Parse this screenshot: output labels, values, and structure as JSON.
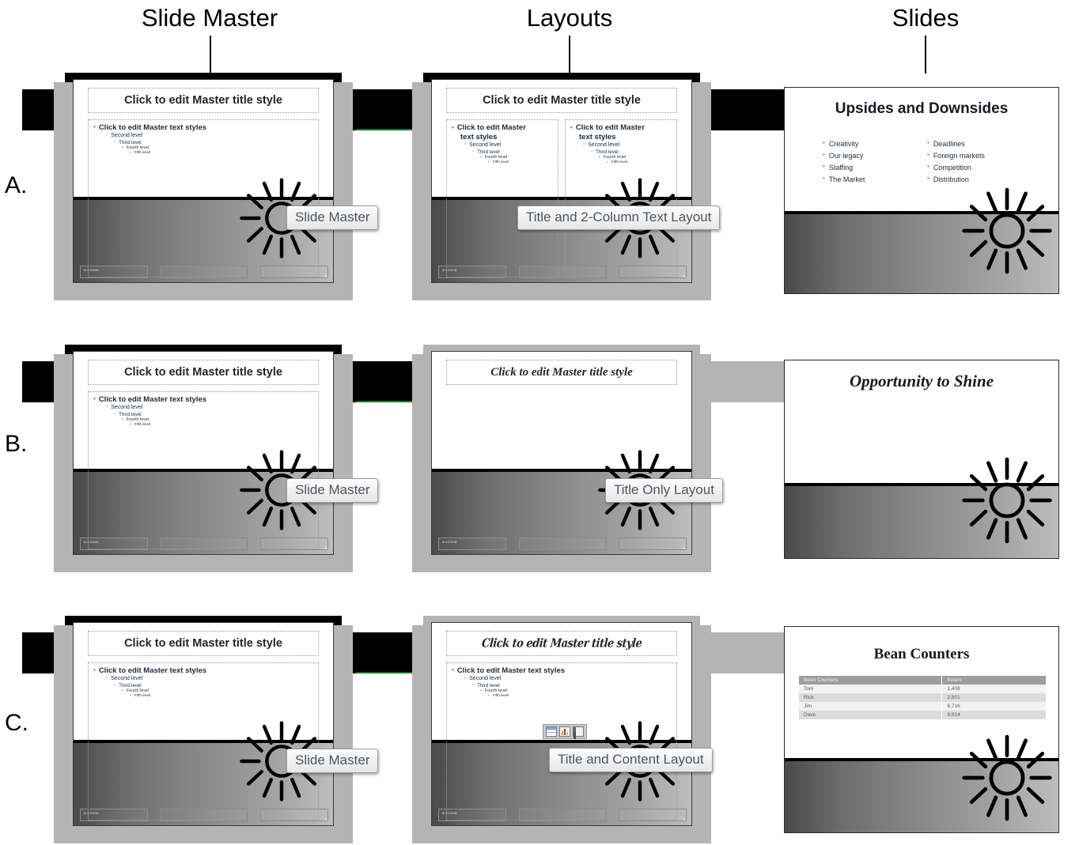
{
  "headers": {
    "slide_master": "Slide Master",
    "layouts": "Layouts",
    "slides": "Slides"
  },
  "row_labels": {
    "a": "A.",
    "b": "B.",
    "c": "C."
  },
  "master": {
    "title_placeholder": "Click to edit Master title style",
    "body_levels": [
      "Click to edit Master text styles",
      "Second level",
      "Third level",
      "Fourth level",
      "Fifth level"
    ],
    "body_levels_wrapped": [
      "Click to edit Master",
      "text styles",
      "Second level",
      "Third level",
      "Fourth level",
      "Fifth level"
    ],
    "footer_date": "8/1/2008",
    "tooltip": "Slide Master"
  },
  "tooltips": {
    "slide_master": "Slide Master",
    "two_column": "Title and 2-Column Text Layout",
    "title_only": "Title Only Layout",
    "title_content": "Title and Content Layout"
  },
  "slides": {
    "a": {
      "title": "Upsides and Downsides",
      "left_bullets": [
        "Creativity",
        "Our legacy",
        "Staffing",
        "The Market"
      ],
      "right_bullets": [
        "Deadlines",
        "Foreign markets",
        "Competition",
        "Distribution"
      ]
    },
    "b": {
      "title": "Opportunity to Shine"
    },
    "c": {
      "title": "Bean Counters",
      "table": {
        "columns": [
          "Bean Counters",
          "Beans"
        ],
        "rows": [
          [
            "Tom",
            "1,408"
          ],
          [
            "Rick",
            "2,801"
          ],
          [
            "Jim",
            "6,716"
          ],
          [
            "Dave",
            "9,914"
          ]
        ]
      }
    }
  },
  "icons": {
    "content_table": "table-icon",
    "content_chart": "chart-icon",
    "content_clipart": "clipart-icon",
    "sun": "sun-graphic",
    "leader_line": "leader-line"
  },
  "colors": {
    "ribbon_black": "#000000",
    "ribbon_gray": "#b4b4b4",
    "accent_green": "#0a7a27",
    "bullet_blue": "#4e86c7",
    "tooltip_text": "#4b5663"
  }
}
